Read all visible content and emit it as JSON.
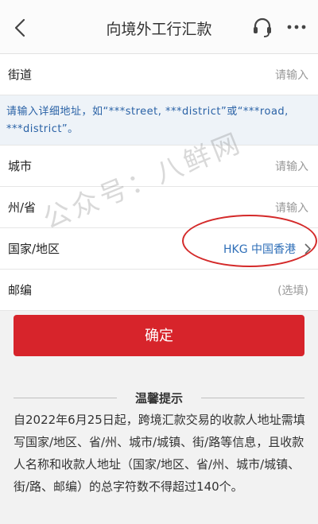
{
  "header": {
    "title": "向境外工行汇款",
    "back_icon": "chevron-left-icon",
    "service_icon": "headset-icon",
    "more_icon": "more-dots-icon"
  },
  "form": {
    "street": {
      "label": "街道",
      "placeholder": "请输入"
    },
    "hint": "请输入详细地址，如“***street, ***district”或“***road, ***district”。",
    "city": {
      "label": "城市",
      "placeholder": "请输入"
    },
    "province": {
      "label": "州/省",
      "placeholder": "请输入"
    },
    "country": {
      "label": "国家/地区",
      "value": "HKG 中国香港"
    },
    "postcode": {
      "label": "邮编",
      "placeholder": "(选填)"
    }
  },
  "confirm_button": "确定",
  "tips": {
    "title": "温馨提示",
    "body": "自2022年6月25日起，跨境汇款交易的收款人地址需填写国家/地区、省/州、城市/城镇、街/路等信息，且收款人名称和收款人地址（国家/地区、省/州、城市/城镇、街/路、邮编）的总字符数不得超过140个。"
  },
  "watermark": "公众号：八鲜网",
  "colors": {
    "accent_red": "#d7242b",
    "link_blue": "#2f6fb8",
    "hint_bg": "#eef3f8"
  }
}
